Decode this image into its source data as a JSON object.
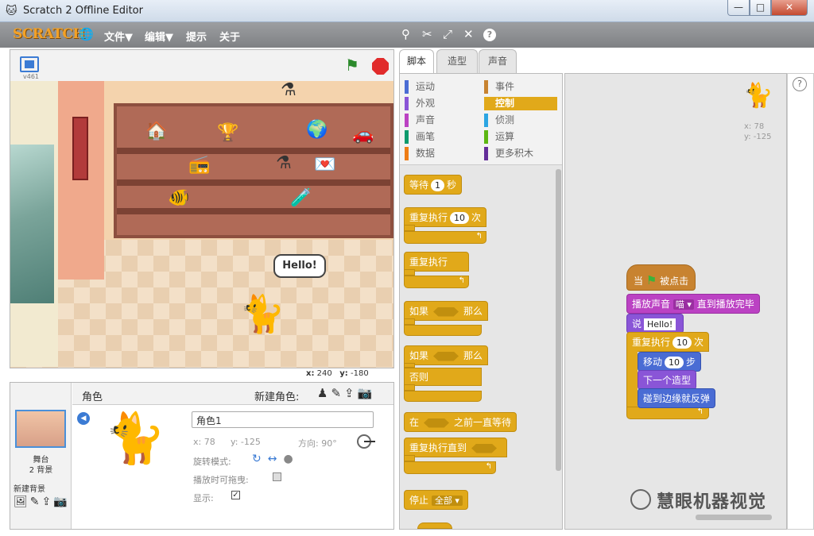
{
  "window": {
    "title": "Scratch 2 Offline Editor",
    "min": "—",
    "max": "□",
    "close": "✕"
  },
  "menubar": {
    "logo": "SCRATCH",
    "items": [
      "文件▼",
      "编辑▼",
      "提示",
      "关于"
    ],
    "tools": [
      "duplicate-icon",
      "cut-icon",
      "grow-icon",
      "shrink-icon",
      "help-icon"
    ]
  },
  "stage": {
    "version": "v461",
    "bubble": "Hello!",
    "coords": {
      "x_label": "x:",
      "x": "240",
      "y_label": "y:",
      "y": "-180"
    }
  },
  "sprite_panel": {
    "stage_label": "舞台",
    "bg_count": "2 背景",
    "new_bg_label": "新建背景",
    "title": "角色",
    "new_sprite_label": "新建角色:",
    "sprite_name": "角色1",
    "x": "x: 78",
    "y": "y: -125",
    "direction": "方向: 90°",
    "rotation_label": "旋转模式:",
    "drag_label": "播放时可拖曳:",
    "show_label": "显示:",
    "show_checked": "✓"
  },
  "tabs": [
    "脚本",
    "造型",
    "声音"
  ],
  "categories": [
    {
      "label": "运动",
      "color": "#4a6cd4"
    },
    {
      "label": "事件",
      "color": "#c88330"
    },
    {
      "label": "外观",
      "color": "#8a55d7"
    },
    {
      "label": "控制",
      "color": "#e1a91a"
    },
    {
      "label": "声音",
      "color": "#bb42c3"
    },
    {
      "label": "侦测",
      "color": "#2ca5e2"
    },
    {
      "label": "画笔",
      "color": "#0e9a6c"
    },
    {
      "label": "运算",
      "color": "#5cb712"
    },
    {
      "label": "数据",
      "color": "#ee7d16"
    },
    {
      "label": "更多积木",
      "color": "#632d99"
    }
  ],
  "palette": {
    "wait": {
      "pre": "等待",
      "num": "1",
      "post": "秒"
    },
    "repeat": {
      "pre": "重复执行",
      "num": "10",
      "post": "次"
    },
    "forever": "重复执行",
    "if_then": {
      "pre": "如果",
      "post": "那么"
    },
    "if_else": {
      "pre": "如果",
      "post": "那么",
      "else": "否则"
    },
    "wait_until": {
      "pre": "在",
      "post": "之前一直等待"
    },
    "repeat_until": "重复执行直到",
    "stop": {
      "pre": "停止",
      "opt": "全部 ▾"
    }
  },
  "script": {
    "x": "x: 78",
    "y": "y: -125",
    "hat": {
      "pre": "当",
      "post": "被点击"
    },
    "play_sound": {
      "pre": "播放声音",
      "opt": "喵 ▾",
      "post": "直到播放完毕"
    },
    "say": {
      "pre": "说",
      "str": "Hello!"
    },
    "repeat": {
      "pre": "重复执行",
      "num": "10",
      "post": "次"
    },
    "move": {
      "pre": "移动",
      "num": "10",
      "post": "步"
    },
    "next_costume": "下一个造型",
    "bounce": "碰到边缘就反弹"
  },
  "watermark": "慧眼机器视觉"
}
